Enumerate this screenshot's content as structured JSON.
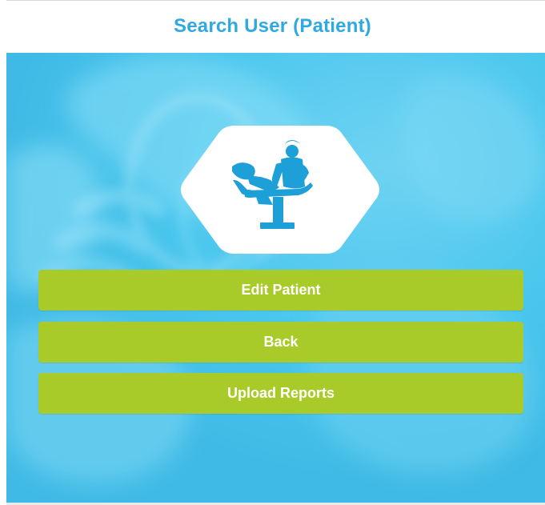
{
  "header": {
    "title": "Search User (Patient)"
  },
  "hero": {
    "icon": "doctor-examining-patient-icon",
    "background": "doctor-with-stethoscope-photo"
  },
  "buttons": {
    "edit_patient": "Edit Patient",
    "back": "Back",
    "upload_reports": "Upload Reports"
  },
  "colors": {
    "title": "#30a9e3",
    "overlay": "#49c6ed",
    "button": "#a8cb2a",
    "icon": "#1d9fd8",
    "hexagon": "#ffffff"
  }
}
